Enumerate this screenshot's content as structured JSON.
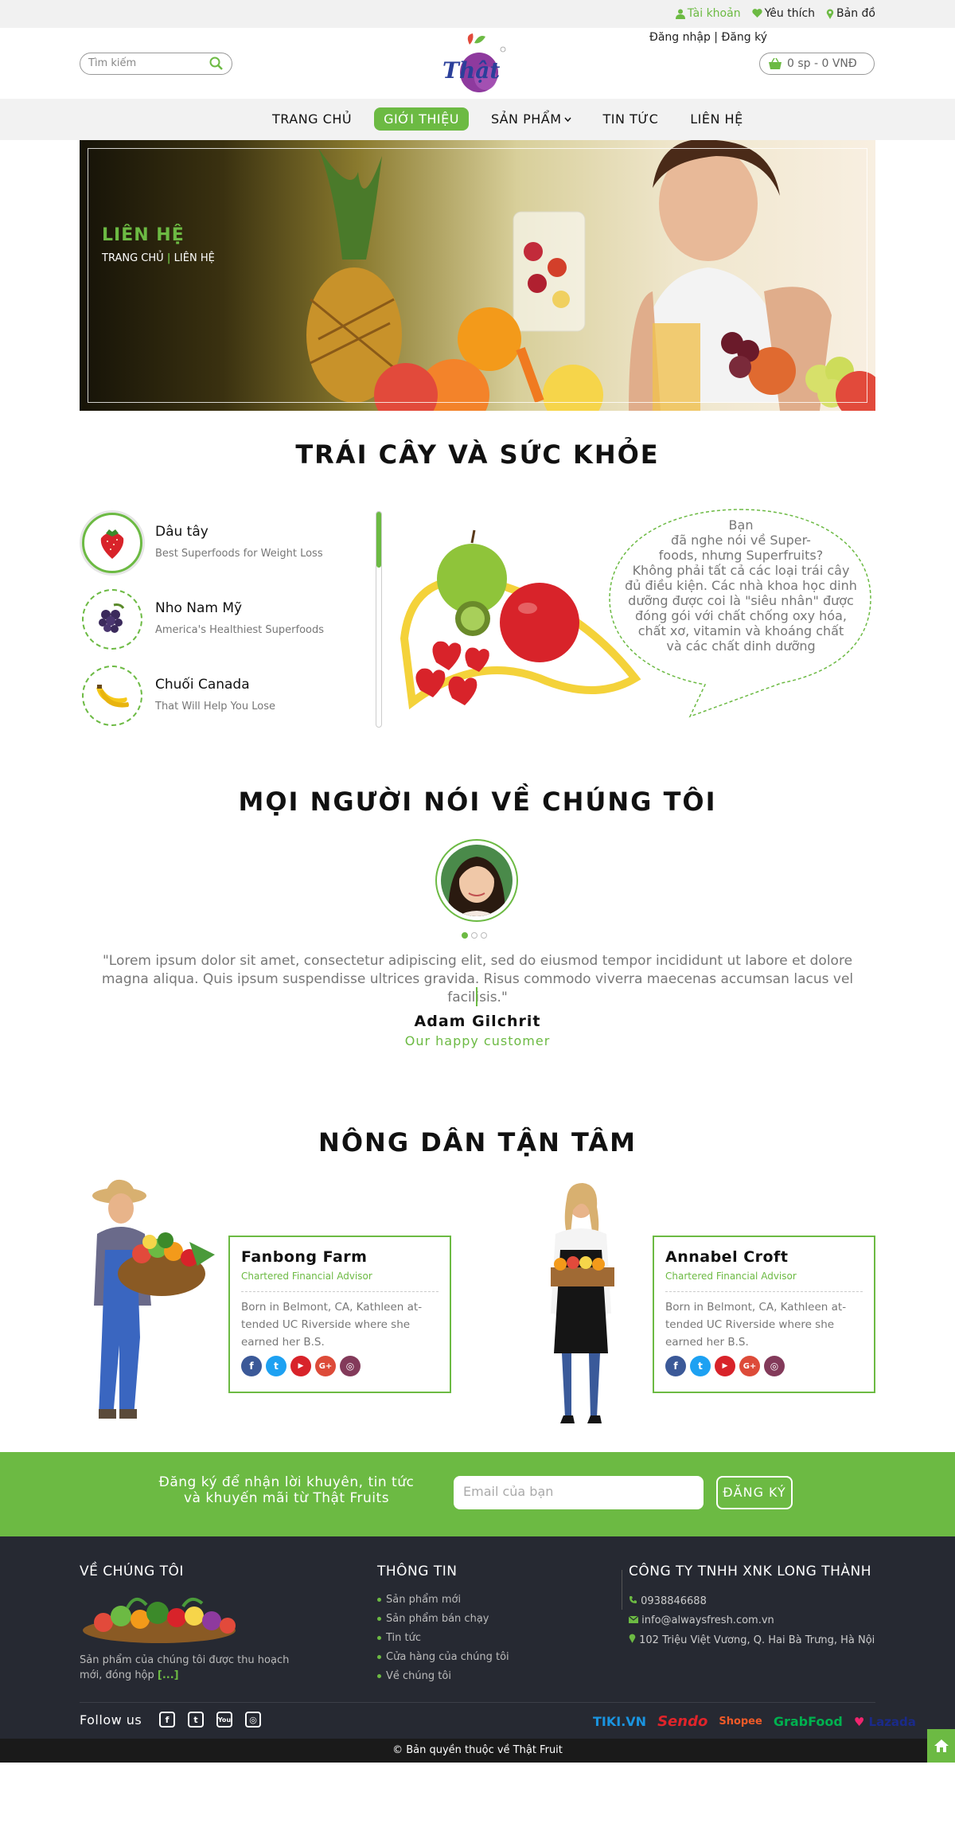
{
  "topbar": {
    "account": "Tài khoản",
    "favorites": "Yêu thích",
    "map": "Bản đồ",
    "login": "Đăng nhập | Đăng ký"
  },
  "search": {
    "placeholder": "Tìm kiếm"
  },
  "logo": {
    "text": "Thật"
  },
  "cart": {
    "label": "0 sp - 0 VNĐ"
  },
  "nav": {
    "items": [
      "TRANG CHỦ",
      "GIỚI THIỆU",
      "SẢN PHẨM",
      "TIN TỨC",
      "LIÊN HỆ"
    ],
    "active_index": 1
  },
  "hero": {
    "title": "LIÊN HỆ",
    "crumb_home": "TRANG CHỦ",
    "crumb_sep": "|",
    "crumb_current": "LIÊN HỆ"
  },
  "health": {
    "title": "TRÁI CÂY VÀ SỨC KHỎE",
    "items": [
      {
        "name": "Dâu tây",
        "desc": "Best Superfoods for Weight Loss"
      },
      {
        "name": "Nho Nam Mỹ",
        "desc": "America's Healthiest Superfoods"
      },
      {
        "name": "Chuối Canada",
        "desc": "That Will Help You Lose"
      }
    ],
    "bubble": "Bạn\nđã nghe nói về Super-\nfoods, nhưng Superfruits?\nKhông phải tất cả các loại trái cây\nđủ điều kiện. Các nhà khoa học dinh\ndưỡng được coi là \"siêu nhân\" được\nđóng gói với chất chống oxy hóa,\nchất xơ, vitamin và khoáng chất\nvà các chất dinh dưỡng"
  },
  "testimonial": {
    "title": "MỌI NGƯỜI NÓI VỀ CHÚNG TÔI",
    "quote": "\"Lorem ipsum dolor sit amet, consectetur adipiscing elit, sed do eiusmod tempor incididunt ut labore et dolore magna aliqua. Quis ipsum suspendisse ultrices gravida. Risus commodo viverra maecenas accumsan lacus vel facilisis.\"",
    "name": "Adam Gilchrit",
    "role": "Our happy customer"
  },
  "farmers": {
    "title": "NÔNG DÂN TẬN TÂM",
    "cards": [
      {
        "name": "Fanbong Farm",
        "role": "Chartered Financial Advisor",
        "bio": "Born in Belmont, CA, Kathleen at-tended UC Riverside where she earned her B.S."
      },
      {
        "name": "Annabel Croft",
        "role": "Chartered Financial Advisor",
        "bio": "Born in Belmont, CA, Kathleen at-tended UC Riverside where she earned her B.S."
      }
    ]
  },
  "newsletter": {
    "text": "Đăng ký để nhận lời khuyên, tin tức và khuyến mãi từ Thật Fruits",
    "placeholder": "Email của bạn",
    "button": "ĐĂNG KÝ"
  },
  "footer": {
    "about_title": "VỀ CHÚNG TÔI",
    "about_text": "Sản phẩm của chúng tôi được thu hoạch mới, đóng hộp",
    "about_more": "[...]",
    "info_title": "THÔNG TIN",
    "info_links": [
      "Sản phẩm mới",
      "Sản phẩm bán chạy",
      "Tin tức",
      "Cửa hàng của chúng tôi",
      "Về chúng tôi"
    ],
    "company_title": "CÔNG TY TNHH XNK LONG THÀNH",
    "phone": "0938846688",
    "email": "info@alwaysfresh.com.vn",
    "address": "102 Triệu Việt Vương, Q. Hai Bà Trưng, Hà Nội",
    "follow": "Follow us",
    "brands": [
      "TIKI.VN",
      "Sendo",
      "Shopee",
      "GrabFood",
      "Lazada"
    ],
    "copyright": "© Bản quyền thuộc về Thật Fruit"
  },
  "colors": {
    "accent": "#6cba43",
    "footer_bg": "#262932"
  }
}
